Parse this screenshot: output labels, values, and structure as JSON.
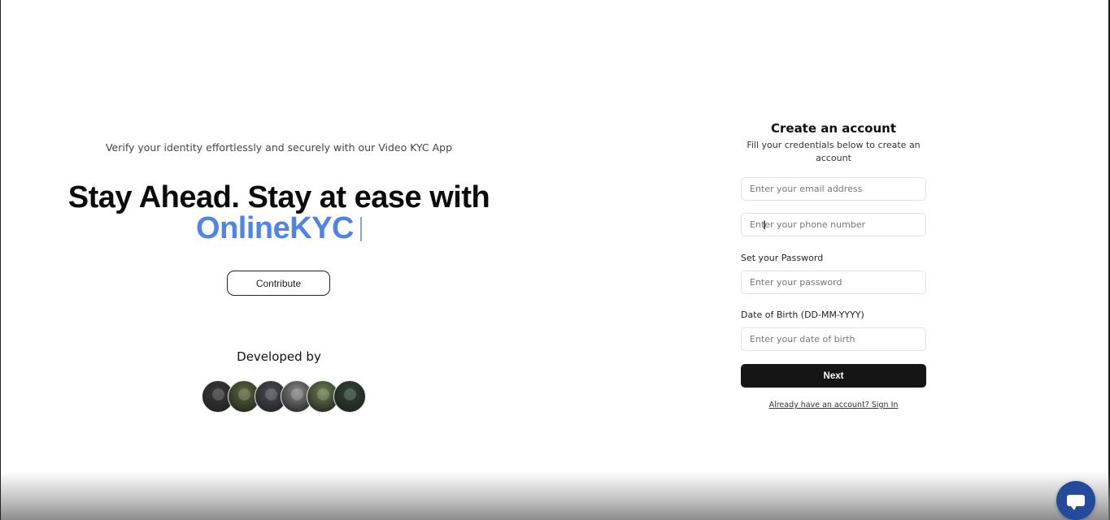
{
  "hero": {
    "tagline": "Verify your identity effortlessly and securely with our Video KYC App",
    "headline": "Stay Ahead. Stay at ease with",
    "brand": "OnlineKYC",
    "contribute_label": "Contribute",
    "developed_by": "Developed by",
    "avatar_colors": [
      "#3a3a3a",
      "#5b6a3c",
      "#4a4d55",
      "#8b8b8b",
      "#6b7f4f",
      "#2f4435"
    ]
  },
  "form": {
    "title": "Create an account",
    "subtitle": "Fill your credentials below to create an account",
    "email_placeholder": "Enter your email address",
    "phone_placeholder": "Enter your phone number",
    "password_label": "Set your Password",
    "password_placeholder": "Enter your password",
    "dob_label": "Date of Birth (DD-MM-YYYY)",
    "dob_placeholder": "Enter your date of birth",
    "next_label": "Next",
    "signin_text": "Already have an account? Sign In"
  },
  "chat": {
    "icon": "chat-bubble-icon",
    "color": "#234a9b"
  },
  "colors": {
    "brand": "#4f84e6",
    "button": "#151515"
  }
}
